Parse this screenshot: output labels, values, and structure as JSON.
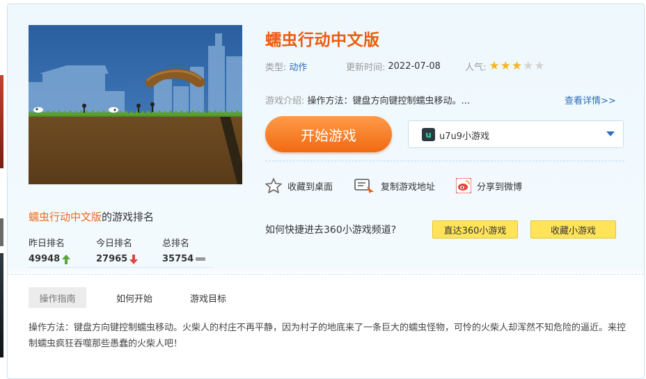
{
  "game": {
    "title": "蠕虫行动中文版",
    "type_label": "类型:",
    "type_value": "动作",
    "update_label": "更新时间:",
    "update_value": "2022-07-08",
    "popularity_label": "人气:",
    "popularity_stars": 3,
    "popularity_max": 5,
    "intro_label": "游戏介绍:",
    "intro_text": "操作方法：键盘方向键控制蠕虫移动。...",
    "more_link": "查看详情>>"
  },
  "actions": {
    "start_button": "开始游戏",
    "server_logo_letter": "u",
    "server_name": "u7u9小游戏",
    "add_desktop": "收藏到桌面",
    "copy_address": "复制游戏地址",
    "share_weibo": "分享到微博"
  },
  "channel": {
    "question": "如何快捷进去360小游戏频道?",
    "goto_button": "直达360小游戏",
    "favorite_button": "收藏小游戏"
  },
  "ranking": {
    "title_game": "蠕虫行动中文版",
    "title_suffix": "的游戏排名",
    "columns": [
      {
        "label": "昨日排名",
        "value": "49948",
        "trend": "up"
      },
      {
        "label": "今日排名",
        "value": "27965",
        "trend": "down"
      },
      {
        "label": "总排名",
        "value": "35754",
        "trend": "flat"
      }
    ]
  },
  "tabs": [
    {
      "label": "操作指南",
      "active": true
    },
    {
      "label": "如何开始",
      "active": false
    },
    {
      "label": "游戏目标",
      "active": false
    }
  ],
  "guide_text": "操作方法：键盘方向键控制蠕虫移动。火柴人的村庄不再平静，因为村子的地底来了一条巨大的蠕虫怪物，可怜的火柴人却浑然不知危险的逼近。来控制蠕虫疯狂吞噬那些愚蠢的火柴人吧！",
  "colors": {
    "accent_orange": "#ec5b10",
    "link_blue": "#2d6bb5",
    "star_on": "#f5b51b",
    "star_off": "#d2d2d2",
    "yellow_button": "#ffe45a",
    "trend_up": "#5aa63a",
    "trend_down": "#e0463c"
  }
}
